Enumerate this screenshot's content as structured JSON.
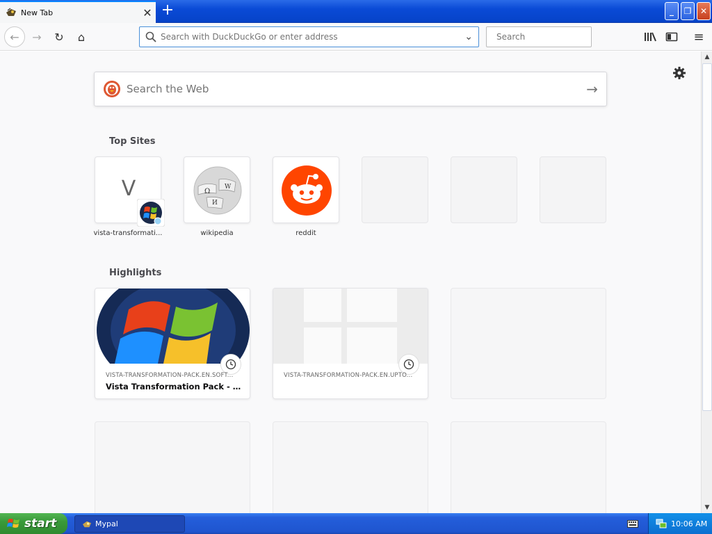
{
  "tab": {
    "title": "New Tab",
    "close": "✕",
    "new_tab": "+"
  },
  "window_controls": {
    "minimize": "_",
    "maximize": "❐",
    "close": "✕"
  },
  "nav": {
    "back": "←",
    "forward": "→",
    "reload": "↻",
    "home": "⌂",
    "url_placeholder": "Search with DuckDuckGo or enter address",
    "url_dropdown": "⌄",
    "search_placeholder": "Search",
    "library": "|||\\",
    "sidebar": "◫",
    "menu": "≡"
  },
  "content": {
    "web_search_placeholder": "Search the Web",
    "web_search_arrow": "→",
    "top_sites_title": "Top Sites",
    "highlights_title": "Highlights",
    "top_sites": [
      {
        "label": "vista-transformati...",
        "letter": "V"
      },
      {
        "label": "wikipedia"
      },
      {
        "label": "reddit"
      }
    ],
    "highlights": [
      {
        "url": "VISTA-TRANSFORMATION-PACK.EN.SOFT...",
        "title": "Vista Transformation Pack - Do..."
      },
      {
        "url": "VISTA-TRANSFORMATION-PACK.EN.UPTO..."
      }
    ]
  },
  "scroll": {
    "up": "▲",
    "down": "▼"
  },
  "taskbar": {
    "start_label": "start",
    "task_label": "Mypal",
    "clock": "10:06 AM"
  },
  "colors": {
    "accent": "#0a84ff",
    "reddit": "#ff4500",
    "ddg": "#de5833",
    "taskbar": "#245edb",
    "start": "#3a9a3a"
  }
}
